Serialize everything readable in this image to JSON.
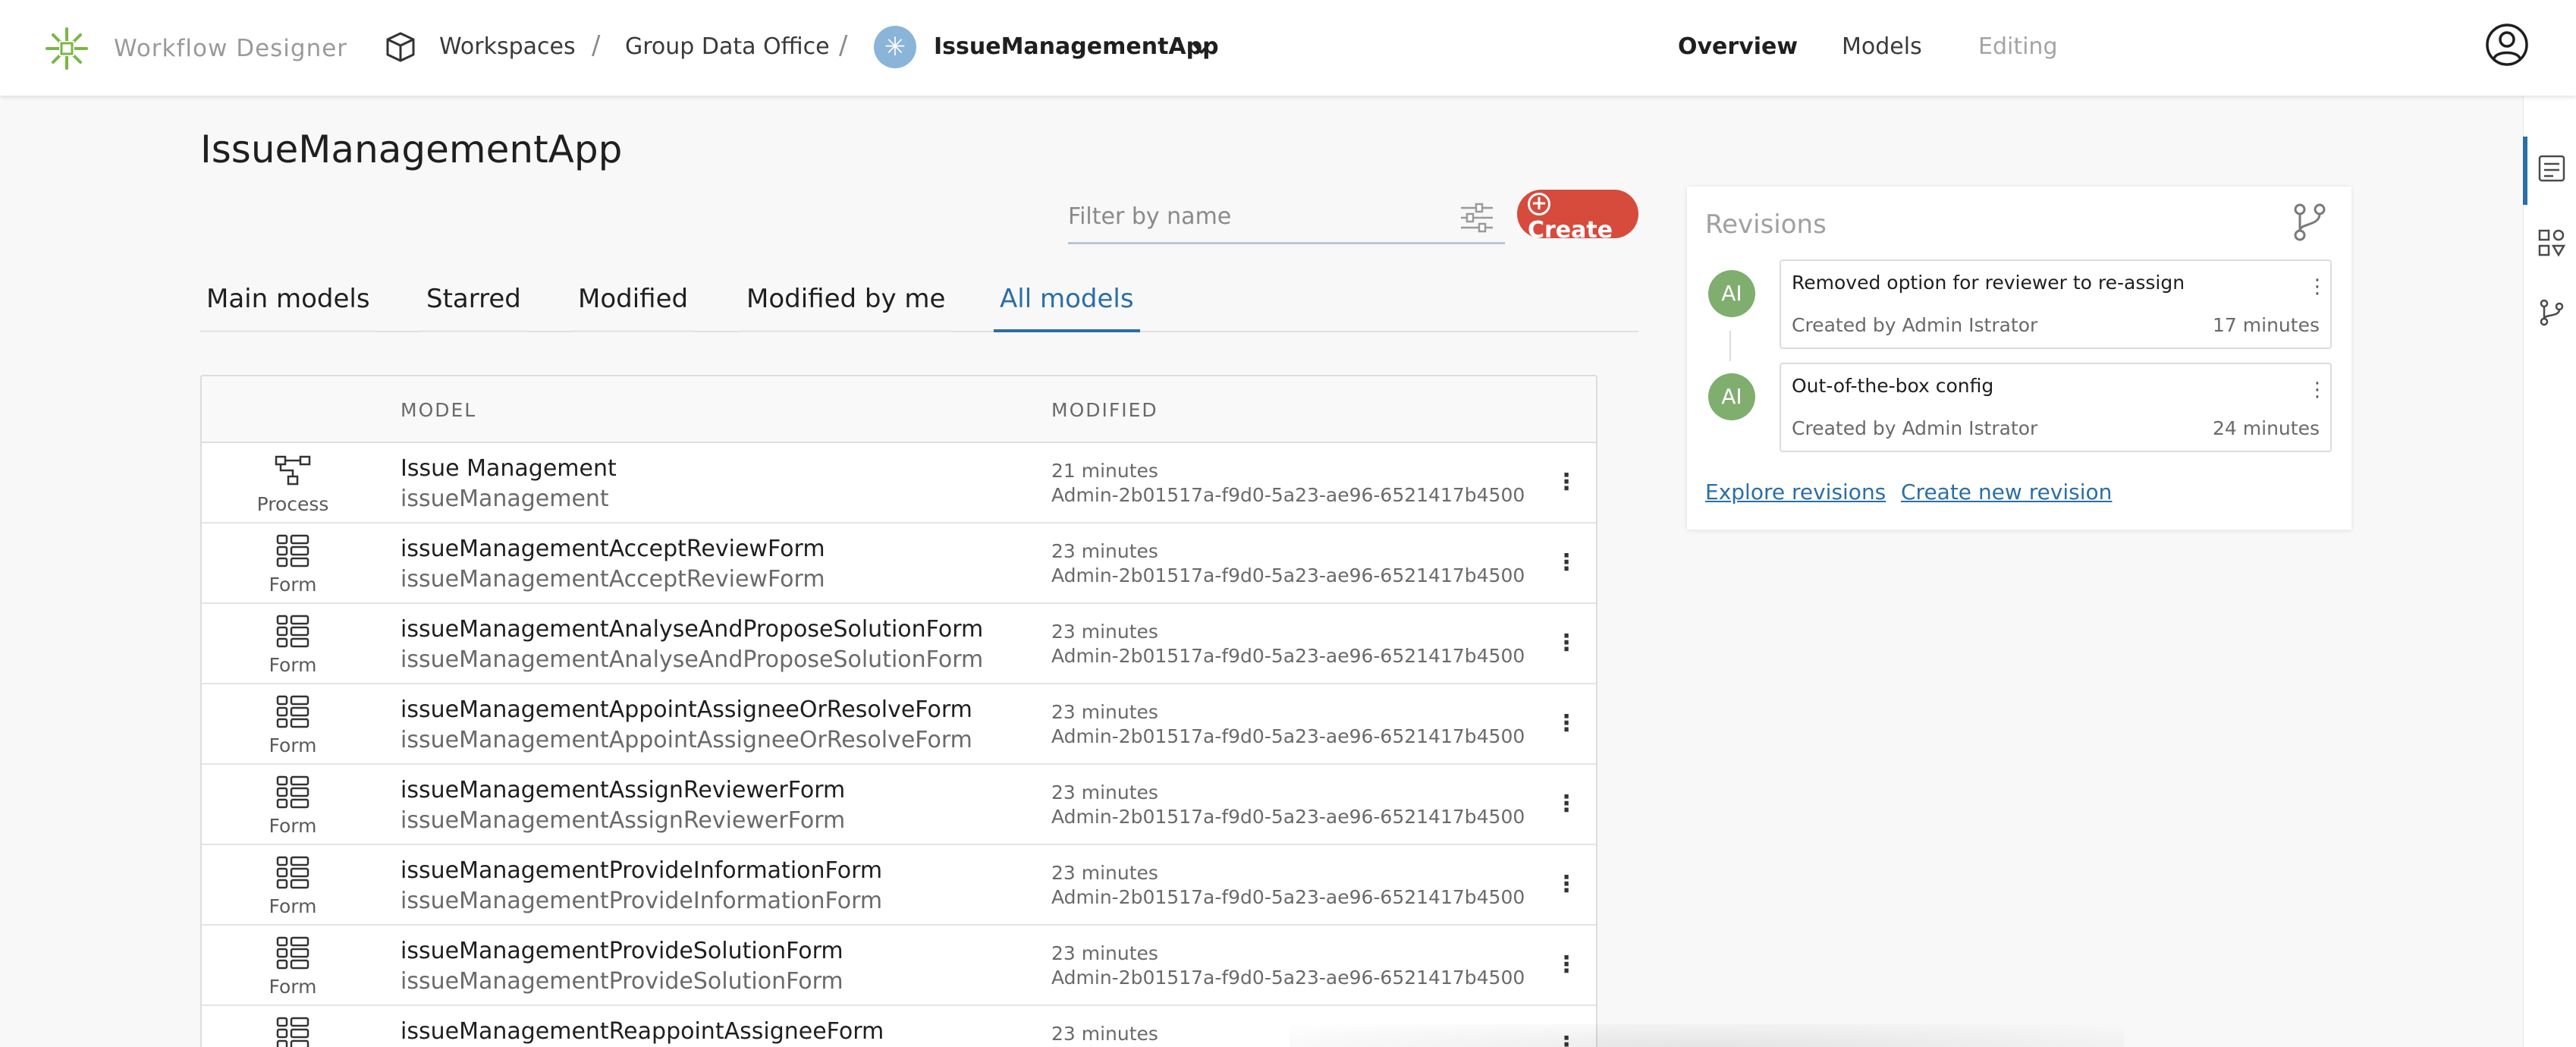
{
  "header": {
    "app_name": "Workflow Designer",
    "breadcrumbs": [
      "Workspaces",
      "Group Data Office"
    ],
    "separator": "/",
    "app_badge_glyph": "✳",
    "current_app": "IssueManagementApp",
    "nav": [
      "Overview",
      "Models",
      "Editing"
    ]
  },
  "page": {
    "title": "IssueManagementApp",
    "filter_placeholder": "Filter by name",
    "create_label": "Create",
    "tabs": [
      "Main models",
      "Starred",
      "Modified",
      "Modified by me",
      "All models"
    ],
    "active_tab": "All models"
  },
  "table": {
    "col_model": "MODEL",
    "col_modified": "MODIFIED",
    "kebab": "⋮",
    "rows": [
      {
        "type": "Process",
        "name": "Issue Management",
        "key": "issueManagement",
        "time": "21 minutes",
        "user": "Admin-2b01517a-f9d0-5a23-ae96-6521417b4500"
      },
      {
        "type": "Form",
        "name": "issueManagementAcceptReviewForm",
        "key": "issueManagementAcceptReviewForm",
        "time": "23 minutes",
        "user": "Admin-2b01517a-f9d0-5a23-ae96-6521417b4500"
      },
      {
        "type": "Form",
        "name": "issueManagementAnalyseAndProposeSolutionForm",
        "key": "issueManagementAnalyseAndProposeSolutionForm",
        "time": "23 minutes",
        "user": "Admin-2b01517a-f9d0-5a23-ae96-6521417b4500"
      },
      {
        "type": "Form",
        "name": "issueManagementAppointAssigneeOrResolveForm",
        "key": "issueManagementAppointAssigneeOrResolveForm",
        "time": "23 minutes",
        "user": "Admin-2b01517a-f9d0-5a23-ae96-6521417b4500"
      },
      {
        "type": "Form",
        "name": "issueManagementAssignReviewerForm",
        "key": "issueManagementAssignReviewerForm",
        "time": "23 minutes",
        "user": "Admin-2b01517a-f9d0-5a23-ae96-6521417b4500"
      },
      {
        "type": "Form",
        "name": "issueManagementProvideInformationForm",
        "key": "issueManagementProvideInformationForm",
        "time": "23 minutes",
        "user": "Admin-2b01517a-f9d0-5a23-ae96-6521417b4500"
      },
      {
        "type": "Form",
        "name": "issueManagementProvideSolutionForm",
        "key": "issueManagementProvideSolutionForm",
        "time": "23 minutes",
        "user": "Admin-2b01517a-f9d0-5a23-ae96-6521417b4500"
      },
      {
        "type": "Form",
        "name": "issueManagementReappointAssigneeForm",
        "key": "",
        "time": "23 minutes",
        "user": ""
      }
    ]
  },
  "revisions": {
    "title": "Revisions",
    "items": [
      {
        "initials": "AI",
        "message": "Removed option for reviewer to re-assign",
        "by": "Created by Admin Istrator",
        "age": "17 minutes"
      },
      {
        "initials": "AI",
        "message": "Out-of-the-box config",
        "by": "Created by Admin Istrator",
        "age": "24 minutes"
      }
    ],
    "explore_link": "Explore revisions",
    "create_link": "Create new revision"
  },
  "icons": [
    "workflow-logo-icon",
    "cube-icon",
    "chevron-down-icon",
    "user-circle-icon",
    "filter-sliders-icon",
    "plus-circle-icon",
    "process-icon",
    "form-icon",
    "kebab-icon",
    "branch-icon",
    "rail-properties-icon",
    "rail-models-icon",
    "rail-revisions-icon"
  ],
  "colors": {
    "accent": "#2b6ea8",
    "create": "#d64b3c",
    "logo": "#7ab648",
    "avatar": "#7fae6e"
  }
}
